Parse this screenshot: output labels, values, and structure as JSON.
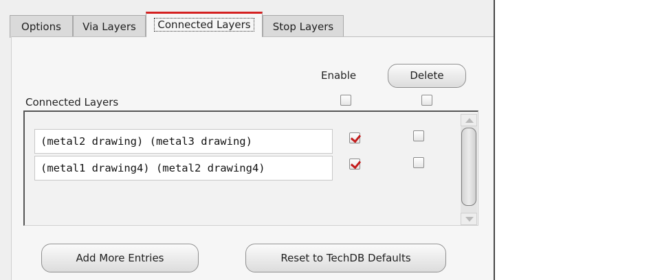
{
  "tabs": [
    {
      "label": "Options",
      "active": false
    },
    {
      "label": "Via Layers",
      "active": false
    },
    {
      "label": "Connected Layers",
      "active": true
    },
    {
      "label": "Stop Layers",
      "active": false
    }
  ],
  "header": {
    "enable_label": "Enable",
    "delete_label": "Delete",
    "enable_all_checked": false,
    "delete_all_checked": false
  },
  "section_label": "Connected Layers",
  "entries": [
    {
      "text": "(metal2 drawing) (metal3 drawing)",
      "enabled": true,
      "delete": false
    },
    {
      "text": "(metal1 drawing4) (metal2 drawing4)",
      "enabled": true,
      "delete": false
    }
  ],
  "buttons": {
    "add_more": "Add More Entries",
    "reset": "Reset to TechDB Defaults"
  },
  "colors": {
    "accent": "#d42020",
    "check": "#c41b1b"
  }
}
